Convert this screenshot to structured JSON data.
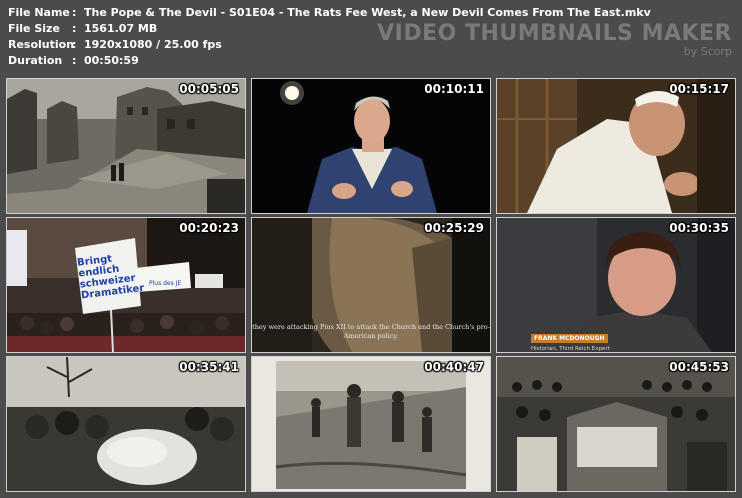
{
  "info": {
    "rows": [
      {
        "label": "File Name",
        "sep": ":",
        "value": "The Pope & The Devil - S01E04 - The Rats Fee West, a New Devil Comes From The East.mkv"
      },
      {
        "label": "File Size",
        "sep": ":",
        "value": "1561.07 MB"
      },
      {
        "label": "Resolution",
        "sep": ":",
        "value": "1920x1080 / 25.00 fps"
      },
      {
        "label": "Duration",
        "sep": ":",
        "value": "00:50:59"
      }
    ]
  },
  "brand": {
    "title": "VIDEO THUMBNAILS MAKER",
    "sub": "by Scorp"
  },
  "thumbs": [
    {
      "time": "00:05:05",
      "scene": "war-ruins"
    },
    {
      "time": "00:10:11",
      "scene": "interview-man-suit"
    },
    {
      "time": "00:15:17",
      "scene": "pope-praying"
    },
    {
      "time": "00:20:23",
      "scene": "protest-signs",
      "signs": {
        "a": "Bringt endlich schweizer Dramatiker",
        "b": "Plus des JE"
      }
    },
    {
      "time": "00:25:29",
      "scene": "face-closeup",
      "subtitle": "they were attacking Pius XII to attack the Church and the Church's pro-American policy."
    },
    {
      "time": "00:30:35",
      "scene": "interview-historian",
      "lowerthird": {
        "name": "FRANK MCDONOUGH",
        "role": "Historian, Third Reich Expert"
      }
    },
    {
      "time": "00:35:41",
      "scene": "crowd-mourning"
    },
    {
      "time": "00:40:47",
      "scene": "soldiers-trench"
    },
    {
      "time": "00:45:53",
      "scene": "assembly-hall"
    }
  ]
}
